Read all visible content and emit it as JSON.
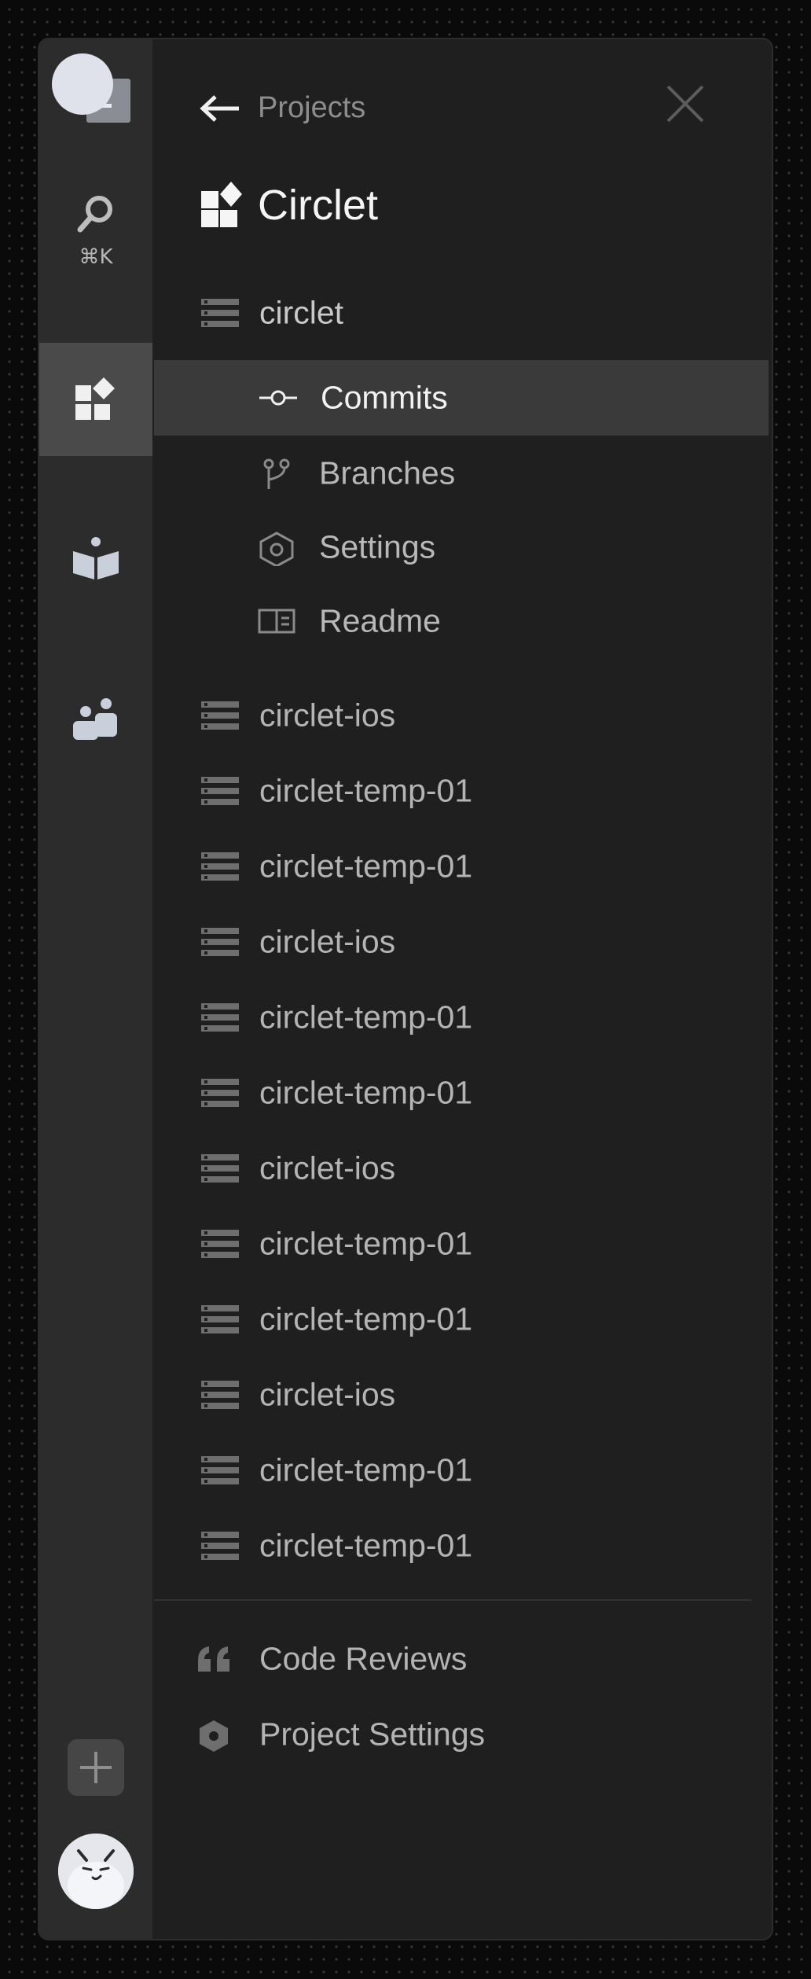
{
  "rail": {
    "search_shortcut": "⌘K"
  },
  "header": {
    "back_label": "Projects",
    "title": "Circlet"
  },
  "project": {
    "repo": "circlet",
    "sub_items": [
      {
        "label": "Commits",
        "icon": "commit-icon",
        "active": true
      },
      {
        "label": "Branches",
        "icon": "branch-icon",
        "active": false
      },
      {
        "label": "Settings",
        "icon": "hexagon-icon",
        "active": false
      },
      {
        "label": "Readme",
        "icon": "readme-icon",
        "active": false
      }
    ],
    "repos": [
      "circlet-ios",
      "circlet-temp-01",
      "circlet-temp-01",
      "circlet-ios",
      "circlet-temp-01",
      "circlet-temp-01",
      "circlet-ios",
      "circlet-temp-01",
      "circlet-temp-01",
      "circlet-ios",
      "circlet-temp-01",
      "circlet-temp-01"
    ]
  },
  "footer": {
    "code_reviews": "Code Reviews",
    "project_settings": "Project Settings"
  },
  "colors": {
    "background": "#0a0a0a",
    "rail": "#2c2c2c",
    "panel": "#1f1f1f",
    "active_row": "#3a3a3a",
    "text_primary": "#f5f5f5",
    "text_secondary": "#b4b4b4"
  }
}
